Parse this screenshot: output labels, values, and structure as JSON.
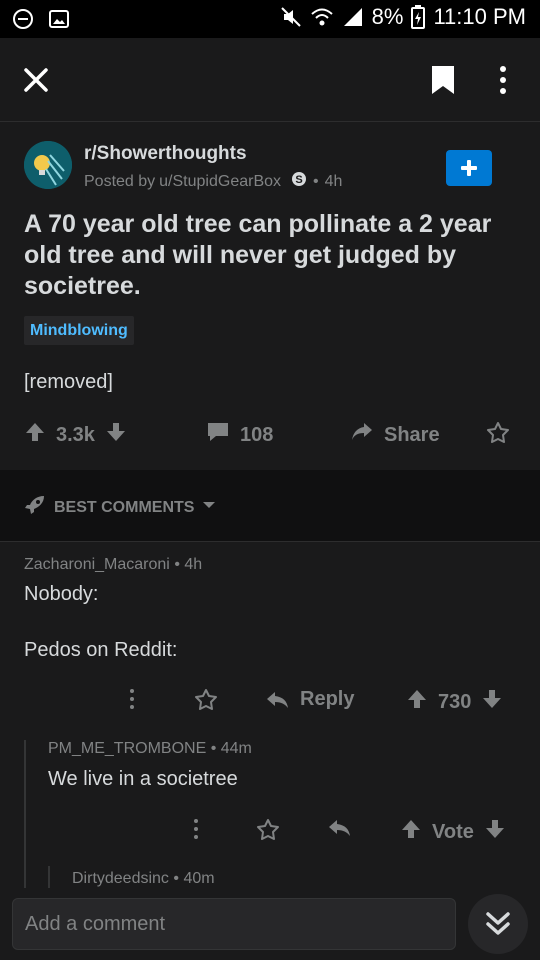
{
  "status_bar": {
    "battery": "8%",
    "time": "11:10 PM"
  },
  "post": {
    "subreddit": "r/Showerthoughts",
    "posted_by_prefix": "Posted by",
    "author": "u/StupidGearBox",
    "age": "4h",
    "title": "A 70 year old tree can pollinate a 2 year old tree and will never get judged by societree.",
    "flair": "Mindblowing",
    "body": "[removed]",
    "score": "3.3k",
    "comment_count": "108",
    "share_label": "Share"
  },
  "sort": {
    "label": "BEST COMMENTS"
  },
  "comments": [
    {
      "author": "Zacharoni_Macaroni",
      "age": "4h",
      "lines": [
        "Nobody:",
        "Pedos on Reddit:"
      ],
      "reply_label": "Reply",
      "score": "730"
    },
    {
      "author": "PM_ME_TROMBONE",
      "age": "44m",
      "text": "We live in a societree",
      "vote_label": "Vote"
    },
    {
      "author": "Dirtydeedsinc",
      "age": "40m"
    }
  ],
  "composer": {
    "placeholder": "Add a comment"
  },
  "colors": {
    "background": "#1a1a1b",
    "accent": "#0079d3",
    "flair_text": "#4fbcff",
    "muted": "#818384",
    "text": "#d7dadc"
  }
}
